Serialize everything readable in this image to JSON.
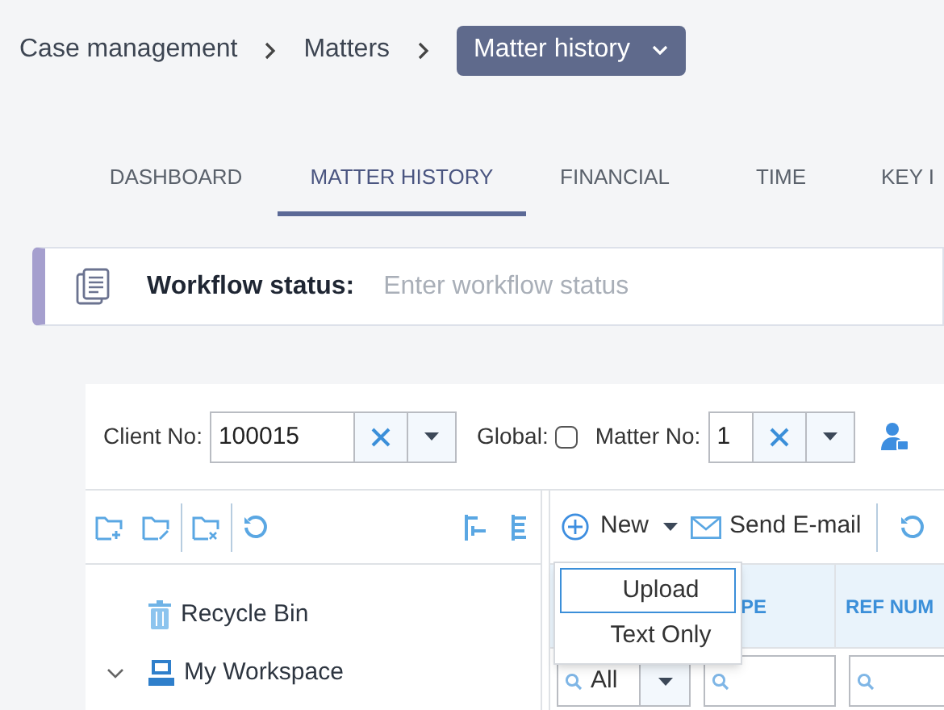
{
  "breadcrumb": [
    {
      "label": "Case management",
      "kind": "link"
    },
    {
      "label": "Matters",
      "kind": "link"
    },
    {
      "label": "Matter history",
      "kind": "dropdown"
    }
  ],
  "tabs": [
    {
      "label": "DASHBOARD",
      "selected": false
    },
    {
      "label": "MATTER HISTORY",
      "selected": true
    },
    {
      "label": "FINANCIAL",
      "selected": false
    },
    {
      "label": "TIME",
      "selected": false
    },
    {
      "label": "KEY I",
      "selected": false
    }
  ],
  "workflow": {
    "label": "Workflow status:",
    "placeholder": "Enter workflow status"
  },
  "filters": {
    "client_no": {
      "label": "Client No:",
      "value": "100015"
    },
    "global": {
      "label": "Global:",
      "checked": false
    },
    "matter_no": {
      "label": "Matter No:",
      "value": "1"
    }
  },
  "tree": [
    {
      "label": "Recycle Bin",
      "kind": "bin"
    },
    {
      "label": "My Workspace",
      "kind": "workspace",
      "expanded": true
    }
  ],
  "toolbar": {
    "new_label": "New",
    "email_label": "Send E-mail"
  },
  "new_menu": [
    {
      "label": "Upload",
      "selected": true
    },
    {
      "label": "Text Only",
      "selected": false
    }
  ],
  "grid": {
    "columns": [
      "PE",
      "REF NUM"
    ],
    "type_filter": "All"
  }
}
